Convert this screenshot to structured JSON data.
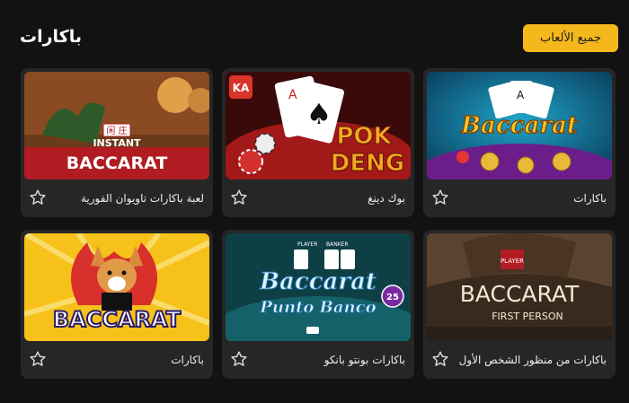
{
  "header": {
    "title": "باكارات",
    "all_games_label": "جميع الألعاب"
  },
  "games": [
    {
      "name": "باكارات",
      "art_text": [
        "Baccarat"
      ],
      "icon": "baccarat-gold-logo"
    },
    {
      "name": "بوك دينغ",
      "art_text": [
        "POK",
        "DENG"
      ],
      "icon": "pok-deng-cards"
    },
    {
      "name": "لعبة باكارات تاويوان الفورية",
      "art_text": [
        "INSTANT",
        "BACCARAT",
        "闲 庄"
      ],
      "icon": "instant-baccarat-table"
    },
    {
      "name": "باكارات من منظور الشخص الأول",
      "art_text": [
        "BACCARAT",
        "FIRST PERSON",
        "PLAYER"
      ],
      "icon": "first-person-baccarat"
    },
    {
      "name": "باكارات بونتو بانكو",
      "art_text": [
        "Baccarat",
        "Punto Banco",
        "25",
        "PLAYER",
        "BANKER"
      ],
      "icon": "punto-banco-table"
    },
    {
      "name": "باكارات",
      "art_text": [
        "BACCARAT"
      ],
      "icon": "corgi-baccarat"
    }
  ],
  "colors": {
    "accent": "#f5b81c",
    "card": "#262626",
    "bg": "#121212"
  }
}
